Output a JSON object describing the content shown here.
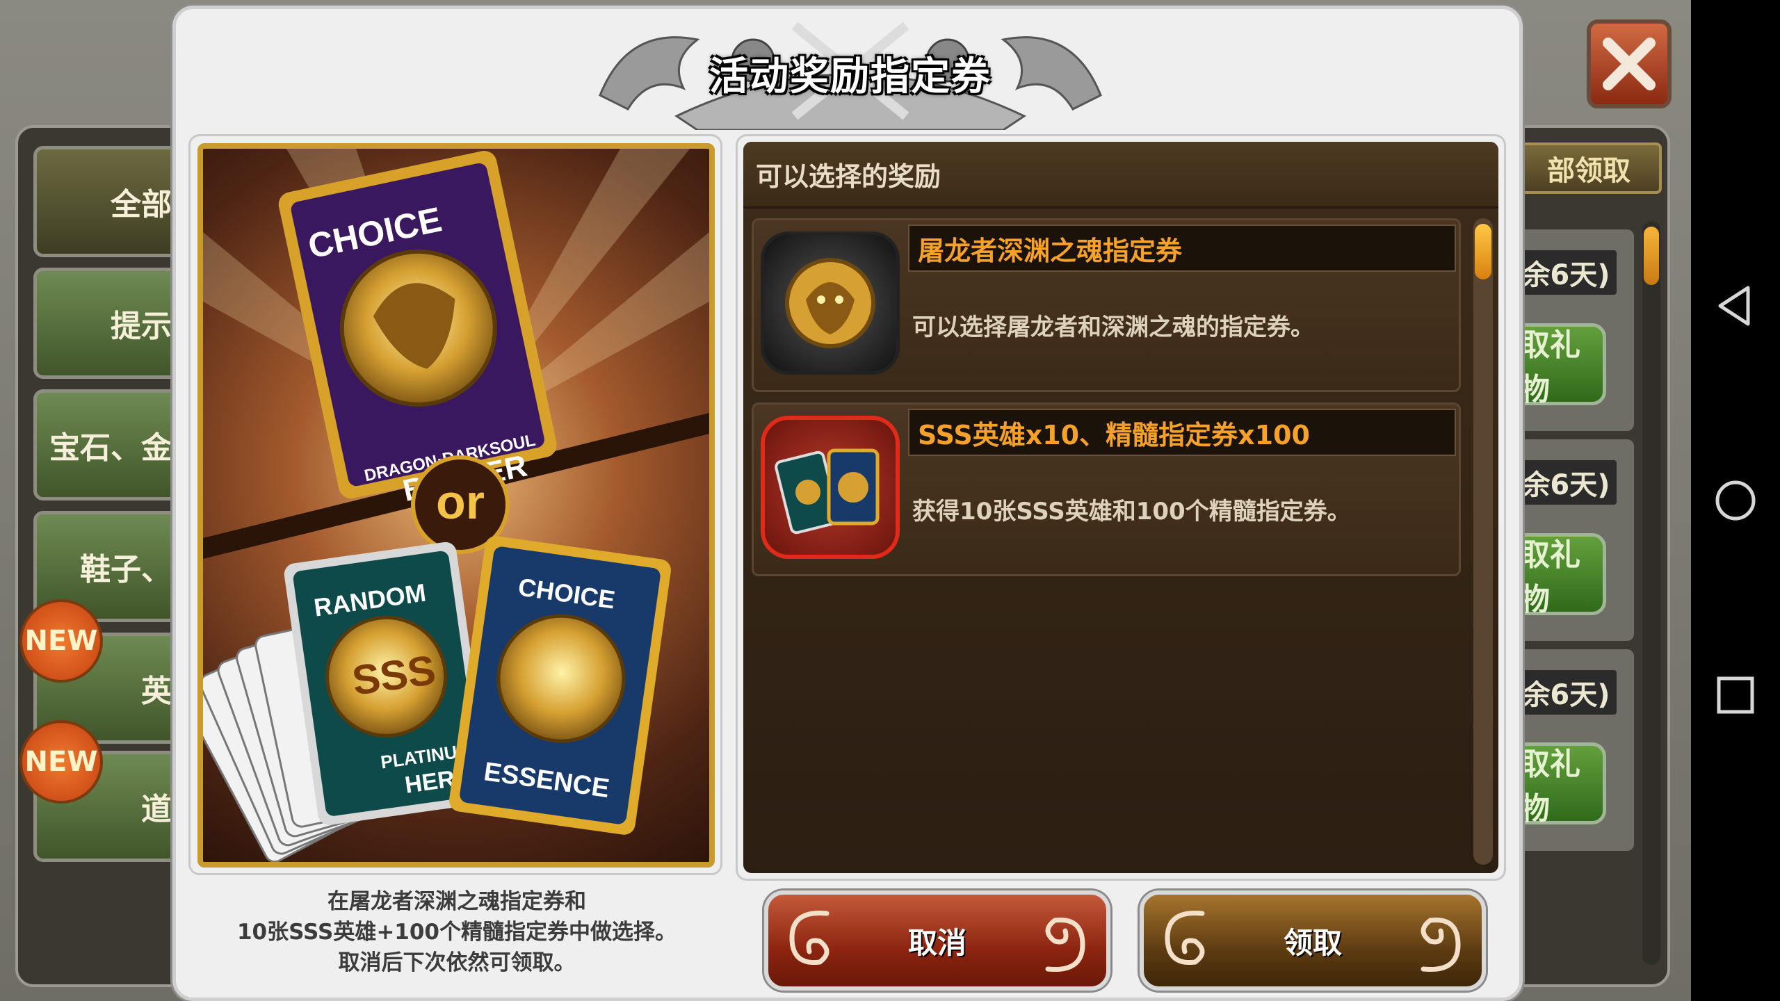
{
  "dialog": {
    "title": "活动奖励指定券",
    "rewards_header": "可以选择的奖励",
    "rewards": [
      {
        "title": "屠龙者深渊之魂指定券",
        "desc": "可以选择屠龙者和深渊之魂的指定券。",
        "icon": "dragon-emblem-icon"
      },
      {
        "title": "SSS英雄x10、精髓指定券x100",
        "desc": "获得10张SSS英雄和100个精髓指定券。",
        "icon": "card-bundle-icon"
      }
    ],
    "footer_note_line1": "在屠龙者深渊之魂指定券和",
    "footer_note_line2": "10张SSS英雄+100个精髓指定券中做选择。",
    "footer_note_line3": "取消后下次依然可领取。",
    "cancel_label": "取消",
    "claim_label": "领取"
  },
  "promo_art": {
    "top_card_title": "CHOICE",
    "top_card_subtitle": "DRAGON·DARKSOUL",
    "top_card_footer": "BUSTER",
    "or_label": "or",
    "left_card_title": "RANDOM",
    "left_card_emblem": "SSS",
    "left_card_footer_1": "PLATINUM",
    "left_card_footer_2": "HERO",
    "right_card_title": "CHOICE",
    "right_card_footer": "ESSENCE"
  },
  "background": {
    "left_tabs": [
      "全部",
      "提示",
      "宝石、金",
      "鞋子、",
      "英",
      "道"
    ],
    "new_badge": "NEW",
    "collect_all_label": "部领取",
    "days_left": [
      "余6天)",
      "余6天)",
      "余6天)"
    ],
    "gift_label": "取礼物"
  },
  "colors": {
    "accent_gold": "#f5a12a",
    "cancel_red": "#8c2410",
    "claim_brown": "#5e3c12"
  }
}
